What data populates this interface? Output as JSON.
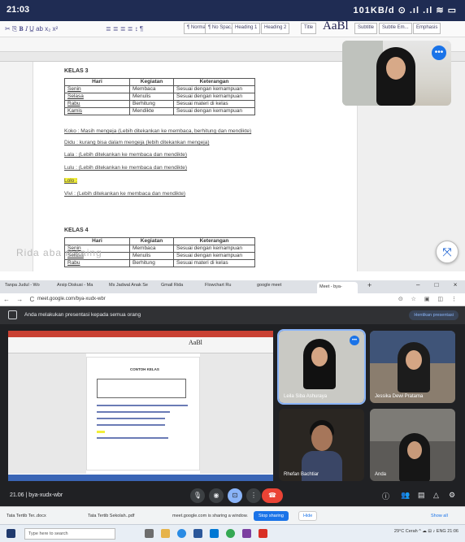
{
  "phone": {
    "time": "21:03",
    "status_right": "101KB/d ⊙ .ıl .ıl ≋ ▭"
  },
  "word": {
    "aabb": "AaBl",
    "styles": [
      "¶ Normal",
      "¶ No Spac...",
      "Heading 1",
      "Heading 2",
      "Title",
      "Subtitle",
      "Subtle Em...",
      "Emphasis"
    ],
    "kelas3": "KELAS 3",
    "kelas4": "KELAS 4",
    "table_headers": [
      "Hari",
      "Kegiatan",
      "Keterangan"
    ],
    "table3_rows": [
      [
        "Senin",
        "Membaca",
        "Sesuai dengan kemampuan"
      ],
      [
        "Selasa",
        "Menulis",
        "Sesuai dengan kemampuan"
      ],
      [
        "Rabu",
        "Berhitung",
        "Sesuai materi di kelas"
      ],
      [
        "Kamis",
        "Mendikte",
        "Sesuai dengan kemampuan"
      ]
    ],
    "table4_rows": [
      [
        "Senin",
        "Membaca",
        "Sesuai dengan kemampuan"
      ],
      [
        "Selasa",
        "Menulis",
        "Sesuai dengan kemampuan"
      ],
      [
        "Rabu",
        "Berhitung",
        "Sesuai materi di kelas"
      ]
    ],
    "notes": [
      "Koko : Masih mengeja (Lebih ditekankan ke membaca, berhitung dan mendikte)",
      "Didu : kurang bisa dalam mengeja (lebih ditekankan mengeja)",
      "Lala : (Lebih ditekankan ke membaca dan mendikte)",
      "Lulu : (Lebih ditekankan ke membaca dan mendikte)",
      "Lolo :",
      "Vivi : (Lebih ditekankan ke membaca dan mendikte)"
    ],
    "watermark": "Rida aba maaing"
  },
  "browser": {
    "tabs": [
      "Tanpa Judul - Wo",
      "Arsip Diskusi - Ma",
      "Ms Jadwal Anak Se",
      "Gmail Rida",
      "Flowchart Ru",
      "Meet - bya-",
      "google meet"
    ],
    "url": "meet.google.com/bya-xudx-wbr",
    "presenting_text": "Anda melakukan presentasi kepada semua orang",
    "stop_presenting": "Hentikan presentasi"
  },
  "shared_doc": {
    "title": "CONTOH KELAS",
    "aabb": "AaBl"
  },
  "meet": {
    "meeting_info": "21.06 | bya-xudx-wbr",
    "participants": [
      {
        "name": "Leila Siba Ashuraya"
      },
      {
        "name": "Jessika Dewi Pratama"
      },
      {
        "name": "Rhefan Bachtiar"
      },
      {
        "name": "Anda"
      }
    ]
  },
  "share_notice": {
    "downloads": [
      "Tata Tertib Ter..docx",
      "Tata Tertib Sekolah..pdf"
    ],
    "text": "meet.google.com is sharing a window.",
    "stop_sharing": "Stop sharing",
    "hide": "Hide",
    "show_all": "Show all"
  },
  "taskbar": {
    "search_placeholder": "Type here to search",
    "tray": "29°C Cerah  ^  ☁ ⊟ ♪ ENG  21:06"
  },
  "colors": {
    "phone_status": "#1f2c53",
    "meet_bg": "#202124",
    "accent": "#1a73e8",
    "end_call": "#ea4335",
    "highlight": "#f2ef3a"
  }
}
